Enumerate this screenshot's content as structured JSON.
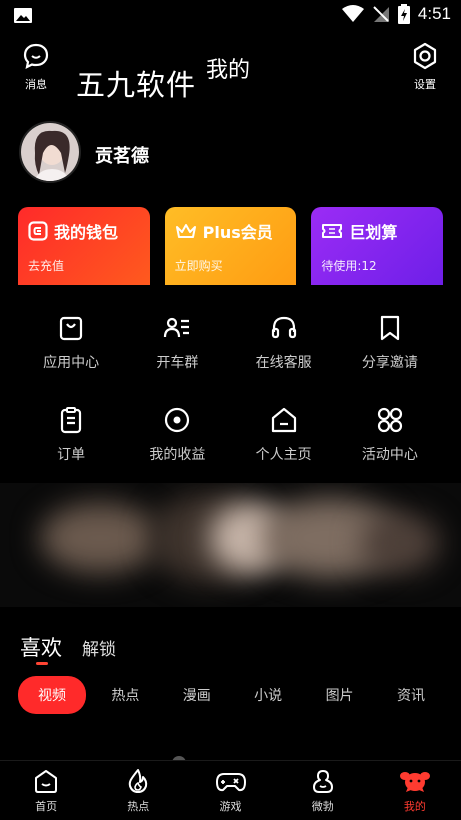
{
  "status": {
    "time": "4:51"
  },
  "header": {
    "messages_label": "消息",
    "settings_label": "设置",
    "watermark": "五九软件",
    "page_title": "我的"
  },
  "profile": {
    "username": "贡茗德"
  },
  "cards": [
    {
      "title": "我的钱包",
      "subtitle": "去充值",
      "icon": "wallet-icon"
    },
    {
      "title": "Plus会员",
      "subtitle": "立即购买",
      "icon": "crown-icon"
    },
    {
      "title": "巨划算",
      "subtitle": "待使用:12",
      "icon": "ticket-icon"
    }
  ],
  "grid": [
    {
      "label": "应用中心",
      "icon": "bag-icon"
    },
    {
      "label": "开车群",
      "icon": "group-icon"
    },
    {
      "label": "在线客服",
      "icon": "headset-icon"
    },
    {
      "label": "分享邀请",
      "icon": "bookmark-icon"
    },
    {
      "label": "订单",
      "icon": "clipboard-icon"
    },
    {
      "label": "我的收益",
      "icon": "target-icon"
    },
    {
      "label": "个人主页",
      "icon": "home-icon"
    },
    {
      "label": "活动中心",
      "icon": "apps-icon"
    }
  ],
  "tabs": {
    "active": "喜欢",
    "other": "解锁"
  },
  "categories": [
    "视频",
    "热点",
    "漫画",
    "小说",
    "图片",
    "资讯"
  ],
  "bottom_nav": [
    {
      "label": "首页",
      "icon": "home-face-icon"
    },
    {
      "label": "热点",
      "icon": "flame-icon"
    },
    {
      "label": "游戏",
      "icon": "gamepad-icon"
    },
    {
      "label": "微勃",
      "icon": "bear-icon"
    },
    {
      "label": "我的",
      "icon": "mine-icon"
    }
  ],
  "colors": {
    "accent": "#ff2a2a",
    "wallet": "#ff3a22",
    "plus": "#ffaa1a",
    "deal": "#8a27f0"
  }
}
